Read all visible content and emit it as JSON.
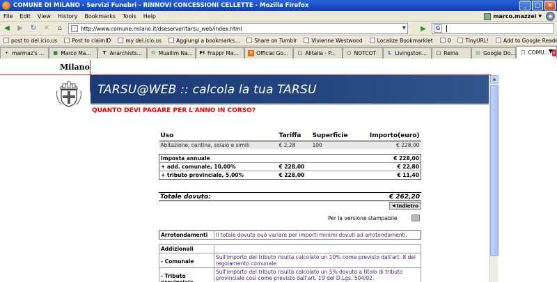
{
  "window": {
    "title": "COMUNE DI MILANO - Servizi Funebri - RINNOVI CONCESSIONI CELLETTE - Mozilla Firefox",
    "min": "_",
    "max": "□",
    "close": "×"
  },
  "menu": {
    "items": [
      "File",
      "Edit",
      "View",
      "History",
      "Bookmarks",
      "Tools",
      "Help"
    ],
    "user": "marco.mazzei",
    "user_arrow": "▼"
  },
  "nav": {
    "back": "◀",
    "forward": "▶",
    "reload": "↻",
    "stop": "✕",
    "home": "⌂",
    "url": "http://www.comune.milano.it/dseserver/tarsu_web/index.html",
    "url_drop": "▼",
    "go": "▶",
    "search_engine": "G"
  },
  "bookmarks": [
    "post to del.icio.us",
    "Post to claimID",
    "my del.icio.us",
    "Aggiungi a bookmarks...",
    "Share on Tumblr",
    "Vivienne Westwood",
    "Localize Bookmarklet",
    "0",
    "TinyURL!",
    "Add to Google Reader"
  ],
  "tabs": [
    {
      "label": "marmaz's ...",
      "icon": "•"
    },
    {
      "label": "Marco Ma...",
      "icon": "■"
    },
    {
      "label": "Anarchists...",
      "icon": "T"
    },
    {
      "label": "Muallim Na...",
      "icon": "G"
    },
    {
      "label": "Frappr Ma...",
      "icon": "F!"
    },
    {
      "label": "Official Go...",
      "icon": "B"
    },
    {
      "label": "Alitalia - P...",
      "icon": "□"
    },
    {
      "label": "NOTCOT",
      "icon": "○"
    },
    {
      "label": "Livingston...",
      "icon": "L"
    },
    {
      "label": "Reina",
      "icon": "□"
    },
    {
      "label": "Google Do...",
      "icon": "▤"
    },
    {
      "label": "COMU...",
      "icon": "□"
    }
  ],
  "tab_close": "×",
  "tab_list": "▼",
  "page": {
    "logo_text": "Milano",
    "banner_title": "TARSU@WEB :: calcola la tua TARSU",
    "question": "QUANTO DEVI PAGARE PER L'ANNO IN CORSO?",
    "table": {
      "headers": {
        "uso": "Uso",
        "tariffa": "Tariffa",
        "superficie": "Superficie",
        "importo": "Importo(euro)"
      },
      "row1": {
        "uso": "Abitazione, cantina, solaio e simili",
        "tariffa": "€ 2,28",
        "superficie": "100",
        "importo": "€ 228,00"
      },
      "imposta": {
        "label": "Imposta annuale",
        "importo": "€ 228,00"
      },
      "add_comunale": {
        "label": "+ add. comunale, 10,00%",
        "base": "€ 228,00",
        "importo": "€ 22,80"
      },
      "tributo": {
        "label": "+ tributo provinciale, 5,00%",
        "base": "€ 228,00",
        "importo": "€ 11,40"
      }
    },
    "total": {
      "label": "Totale dovuto:",
      "value": "€ 262,20"
    },
    "back_button": "Indietro",
    "back_arrow": "◀",
    "print_link": "Per la versione stampabile",
    "arrotondamenti": {
      "label": "Arrotondamenti",
      "text": "Il totale dovuto può variare per importi minimi dovuti ad arrotondamenti."
    },
    "addizionali": {
      "label": "Addizionali",
      "comunale_label": "- Comunale",
      "comunale_text": "Sull'importo del tributo risulta calcolato un 10% come previsto dall'art. 8 del regolamento comunale",
      "provinciale_label": "- Tributo provinciale",
      "provinciale_text": "Sull'importo del tributo risulta calcolato un 5% dovuto a titolo di tributo provinciale così come previsto dall'art. 19 del D.Lgs. 504/92."
    },
    "scroll_up": "▲"
  },
  "colors": {
    "accent_red": "#e00000",
    "banner_blue": "#1b3a78",
    "text_purple": "#4a1e6a"
  }
}
